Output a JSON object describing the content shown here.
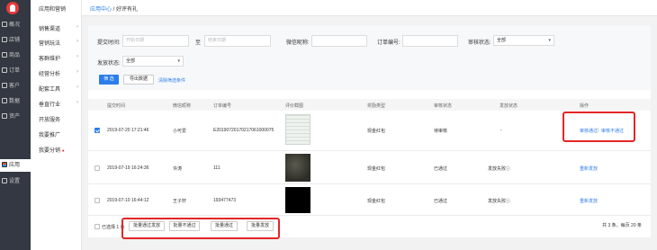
{
  "nav_main": [
    {
      "label": "概况",
      "icon": "overview-icon"
    },
    {
      "label": "店铺",
      "icon": "store-icon"
    },
    {
      "label": "商品",
      "icon": "goods-icon"
    },
    {
      "label": "订单",
      "icon": "order-icon"
    },
    {
      "label": "客户",
      "icon": "customer-icon"
    },
    {
      "label": "数据",
      "icon": "data-icon"
    },
    {
      "label": "资产",
      "icon": "assets-icon"
    },
    {
      "label": "应用",
      "icon": "app-icon",
      "active": true
    },
    {
      "label": "设置",
      "icon": "settings-icon"
    }
  ],
  "nav_sub": {
    "header": "应用和营销",
    "items": [
      {
        "label": "销售渠道",
        "arrow": "›"
      },
      {
        "label": "营销玩法",
        "arrow": "›"
      },
      {
        "label": "客群维护",
        "arrow": "›"
      },
      {
        "label": "经营分析",
        "arrow": "›"
      },
      {
        "label": "配套工具",
        "arrow": "›"
      },
      {
        "label": "垂直行业",
        "arrow": "›"
      },
      {
        "label": "开放服务",
        "arrow": ""
      },
      {
        "label": "我要推广",
        "arrow": ""
      },
      {
        "label": "我要分销",
        "arrow": "",
        "dot": "●"
      }
    ]
  },
  "breadcrumb": {
    "link": "应用中心",
    "sep": " / ",
    "current": "好评有礼"
  },
  "filters": {
    "submit_time_label": "提交时间:",
    "start_placeholder": "开始日期",
    "to": "至",
    "end_placeholder": "结束日期",
    "nickname_label": "微信昵称:",
    "order_no_label": "订单编号:",
    "audit_status_label": "审核状态:",
    "audit_status_value": "全部",
    "send_status_label": "发放状态:",
    "send_status_value": "全部",
    "search_button": "筛 选",
    "export_button": "导出数据",
    "clear_link": "清除筛选条件"
  },
  "table": {
    "columns": [
      "提交时间",
      "微信昵称",
      "订单编号",
      "评价截图",
      "奖励类型",
      "审核状态",
      "发放状态",
      "操作"
    ],
    "rows": [
      {
        "checked": true,
        "time": "2019-07-20 17:21:46",
        "nickname": "小可爱",
        "order_no": "E20190720170217061000075",
        "reward": "现金红包",
        "audit": "待审核",
        "send": "-",
        "ops": [
          "审核通过",
          "审核不通过"
        ],
        "thumb": "screenshot-thumb"
      },
      {
        "checked": false,
        "time": "2019-07-19 16:24:36",
        "nickname": "许涛",
        "order_no": "111",
        "reward": "现金红包",
        "audit": "已通过",
        "send": "发放失败ⓘ",
        "ops": [
          "重新发放"
        ],
        "thumb": "dark-photo"
      },
      {
        "checked": false,
        "time": "2019-07-10 16:44:12",
        "nickname": "王子轩",
        "order_no": "193477473",
        "reward": "现金红包",
        "audit": "已通过",
        "send": "发放失败ⓘ",
        "ops": [
          "重新发放"
        ],
        "thumb": "black-photo"
      }
    ]
  },
  "footer": {
    "selected_label": "已选择 1 条",
    "bulk_buttons": [
      "批量通过发放",
      "批量不通过",
      "批量通过",
      "批量发放"
    ],
    "pager_text": "共 3 条，每页 20 条"
  },
  "colors": {
    "accent": "#2b7de9",
    "highlight": "#e32626",
    "sidebar": "#333842"
  }
}
